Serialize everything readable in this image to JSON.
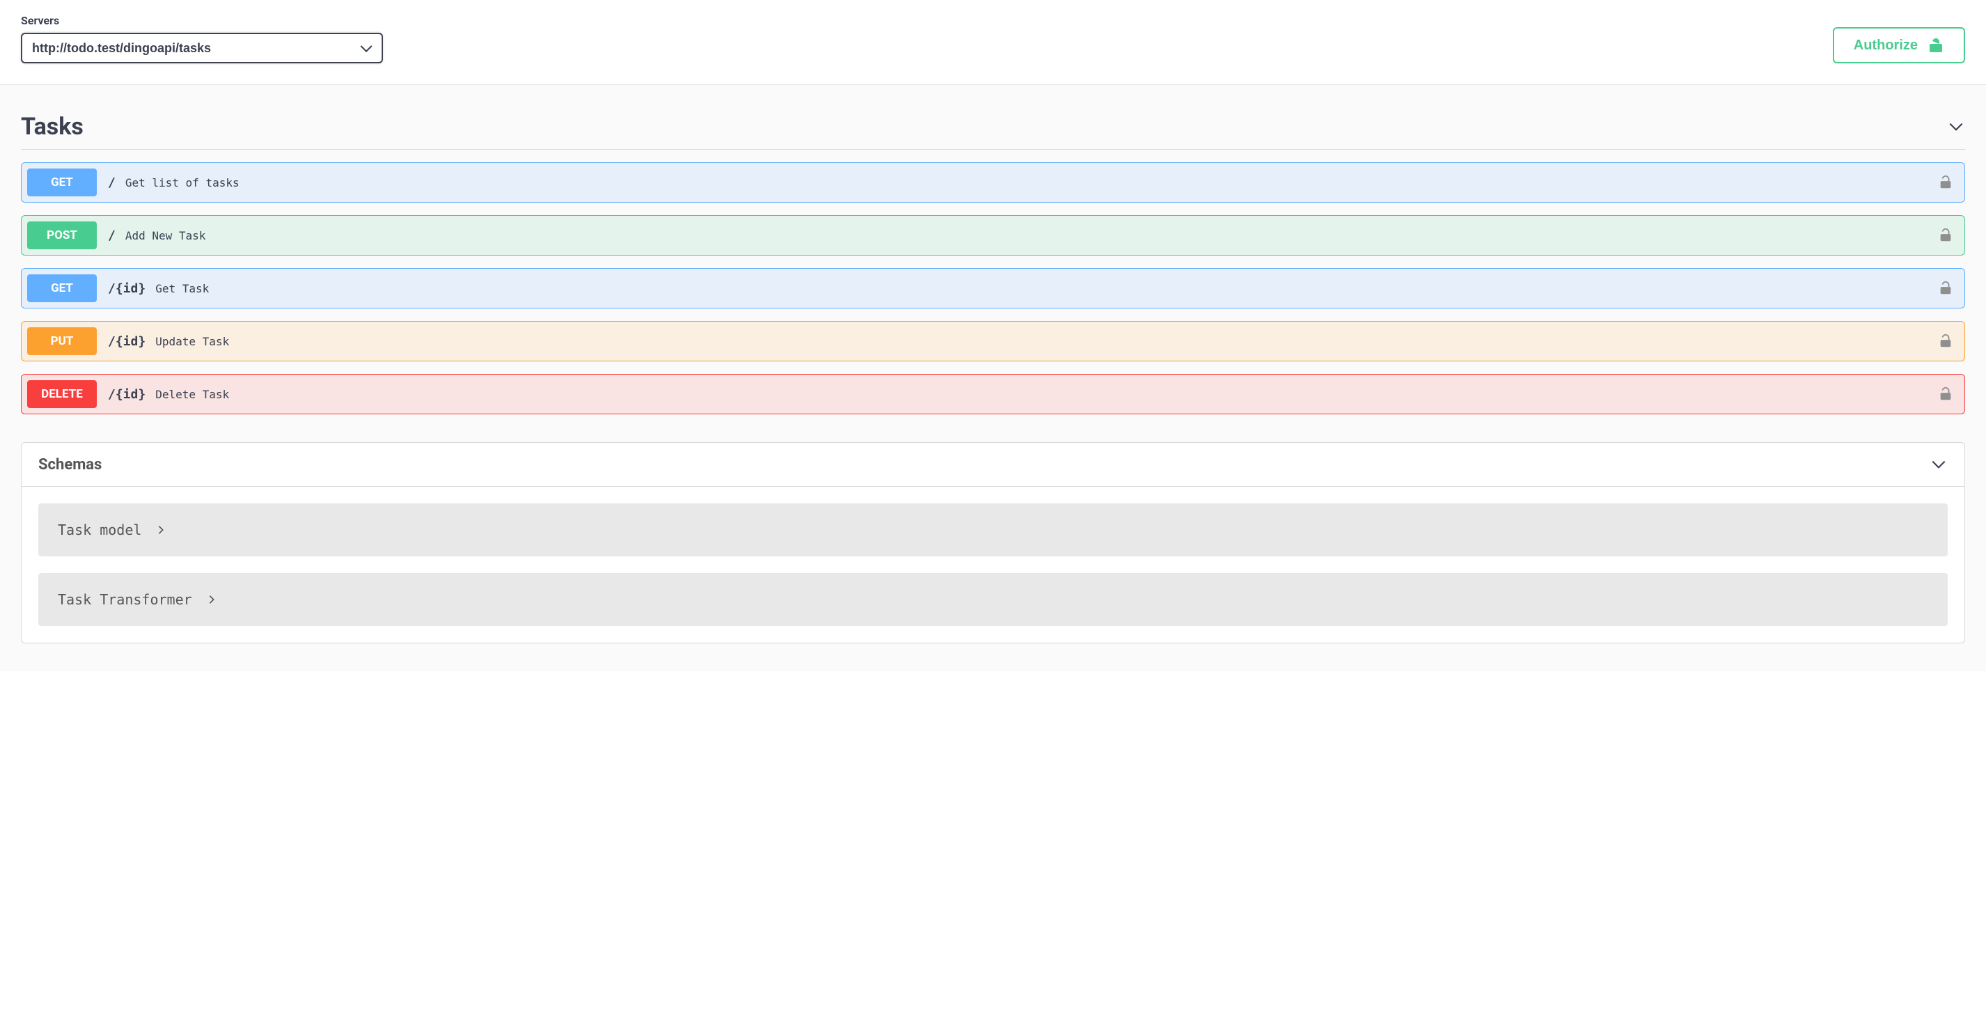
{
  "servers": {
    "label": "Servers",
    "selected": "http://todo.test/dingoapi/tasks"
  },
  "authorize": {
    "label": "Authorize"
  },
  "tag": {
    "name": "Tasks"
  },
  "operations": [
    {
      "method": "GET",
      "methodClass": "get",
      "path": "/",
      "summary": "Get list of tasks"
    },
    {
      "method": "POST",
      "methodClass": "post",
      "path": "/",
      "summary": "Add New Task"
    },
    {
      "method": "GET",
      "methodClass": "get",
      "path": "/{id}",
      "summary": "Get Task"
    },
    {
      "method": "PUT",
      "methodClass": "put",
      "path": "/{id}",
      "summary": "Update Task"
    },
    {
      "method": "DELETE",
      "methodClass": "delete",
      "path": "/{id}",
      "summary": "Delete Task"
    }
  ],
  "schemas": {
    "heading": "Schemas",
    "models": [
      {
        "name": "Task model"
      },
      {
        "name": "Task Transformer"
      }
    ]
  },
  "colors": {
    "get": "#61affe",
    "post": "#49cc90",
    "put": "#fca130",
    "delete": "#f93e3e",
    "accent": "#49cc90"
  }
}
